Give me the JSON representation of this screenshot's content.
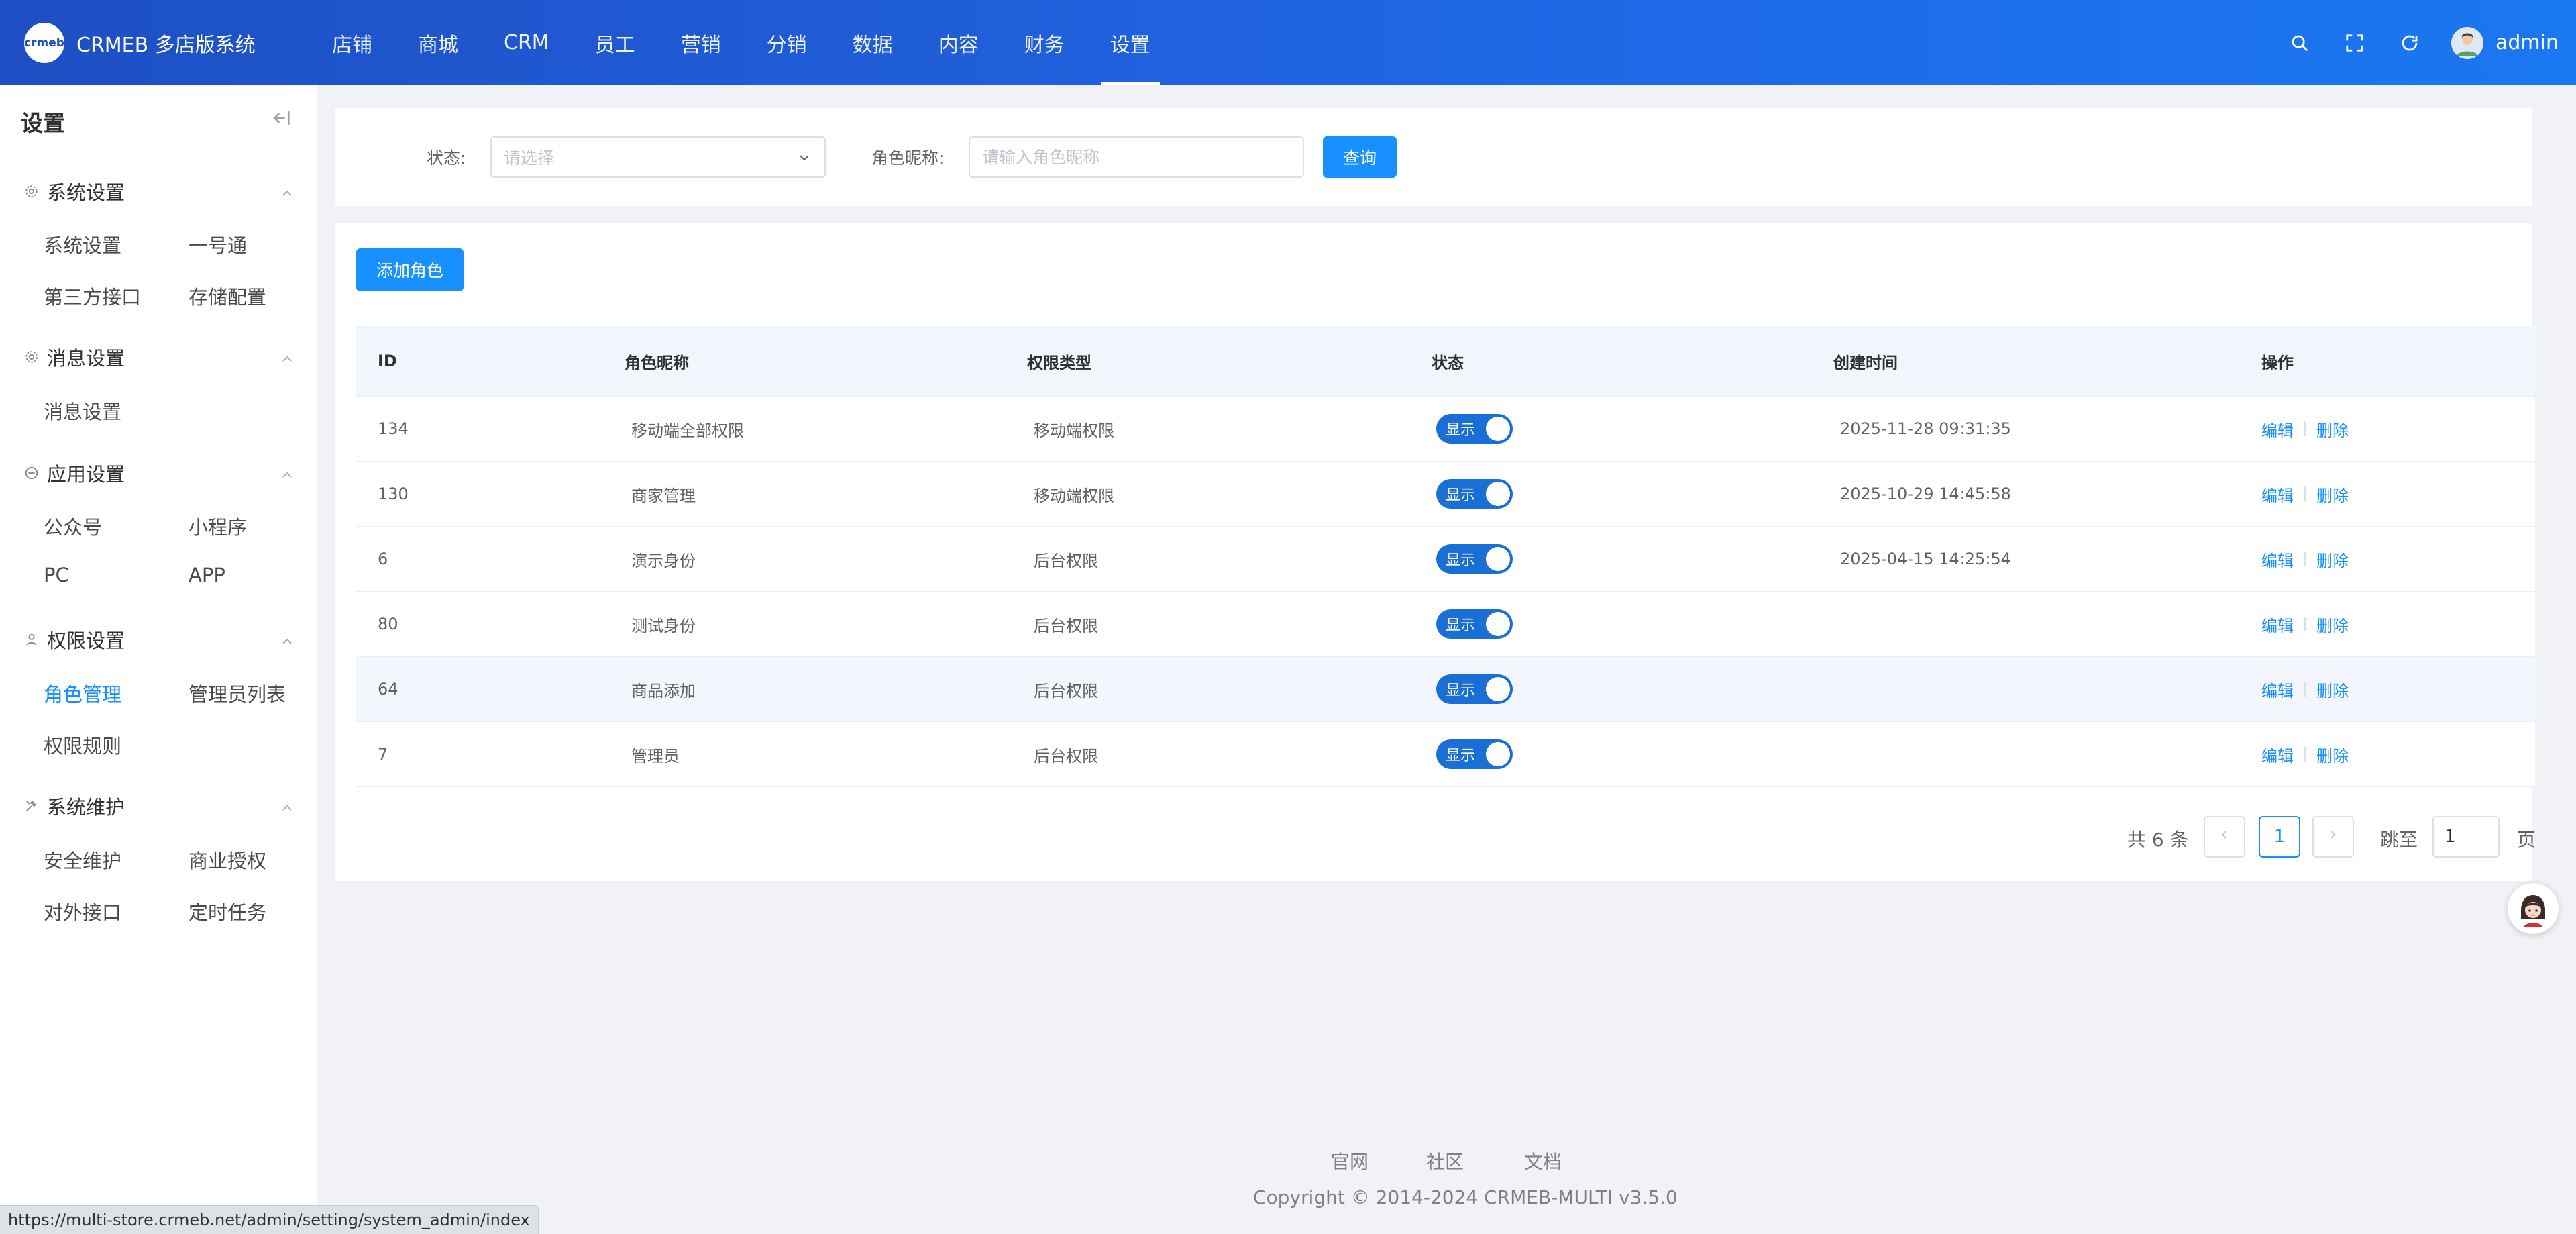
{
  "header": {
    "logo_mark": "crmeb",
    "app_title": "CRMEB 多店版系统",
    "nav": [
      "店铺",
      "商城",
      "CRM",
      "员工",
      "营销",
      "分销",
      "数据",
      "内容",
      "财务",
      "设置"
    ],
    "active_nav": "设置",
    "user_name": "admin",
    "icons": [
      "search-icon",
      "fullscreen-icon",
      "refresh-icon"
    ]
  },
  "sidebar": {
    "title": "设置",
    "groups": [
      {
        "title": "系统设置",
        "icon": "gear-icon",
        "items": [
          "系统设置",
          "一号通",
          "第三方接口",
          "存储配置"
        ]
      },
      {
        "title": "消息设置",
        "icon": "gear-icon",
        "items": [
          "消息设置"
        ]
      },
      {
        "title": "应用设置",
        "icon": "app-icon",
        "items": [
          "公众号",
          "小程序",
          "PC",
          "APP"
        ]
      },
      {
        "title": "权限设置",
        "icon": "user-icon",
        "items": [
          "角色管理",
          "管理员列表",
          "权限规则"
        ]
      },
      {
        "title": "系统维护",
        "icon": "tools-icon",
        "items": [
          "安全维护",
          "商业授权",
          "对外接口",
          "定时任务"
        ]
      }
    ],
    "active_item": "角色管理"
  },
  "filter": {
    "status_label": "状态:",
    "status_placeholder": "请选择",
    "name_label": "角色昵称:",
    "name_placeholder": "请输入角色昵称",
    "query_button": "查询"
  },
  "toolbar": {
    "add_button": "添加角色"
  },
  "table": {
    "columns": [
      "ID",
      "角色昵称",
      "权限类型",
      "状态",
      "创建时间",
      "操作"
    ],
    "rows": [
      {
        "id": "134",
        "name": "移动端全部权限",
        "type": "移动端权限",
        "status": "显示",
        "created": "2025-11-28 09:31:35"
      },
      {
        "id": "130",
        "name": "商家管理",
        "type": "移动端权限",
        "status": "显示",
        "created": "2025-10-29 14:45:58"
      },
      {
        "id": "6",
        "name": "演示身份",
        "type": "后台权限",
        "status": "显示",
        "created": "2025-04-15 14:25:54"
      },
      {
        "id": "80",
        "name": "测试身份",
        "type": "后台权限",
        "status": "显示",
        "created": ""
      },
      {
        "id": "64",
        "name": "商品添加",
        "type": "后台权限",
        "status": "显示",
        "created": ""
      },
      {
        "id": "7",
        "name": "管理员",
        "type": "后台权限",
        "status": "显示",
        "created": ""
      }
    ],
    "edit_label": "编辑",
    "delete_label": "删除"
  },
  "pagination": {
    "total_text": "共 6 条",
    "current_page": "1",
    "jump_label": "跳至",
    "jump_value": "1",
    "page_suffix": "页"
  },
  "footer": {
    "links": [
      "官网",
      "社区",
      "文档"
    ],
    "copyright": "Copyright © 2014-2024 CRMEB-MULTI v3.5.0"
  },
  "status_url": "https://multi-store.crmeb.net/admin/setting/system_admin/index",
  "colors": {
    "header_start": "#1e4fc4",
    "header_end": "#1a78f2",
    "primary": "#1890ff",
    "toggle_on": "#1a6fd6"
  }
}
